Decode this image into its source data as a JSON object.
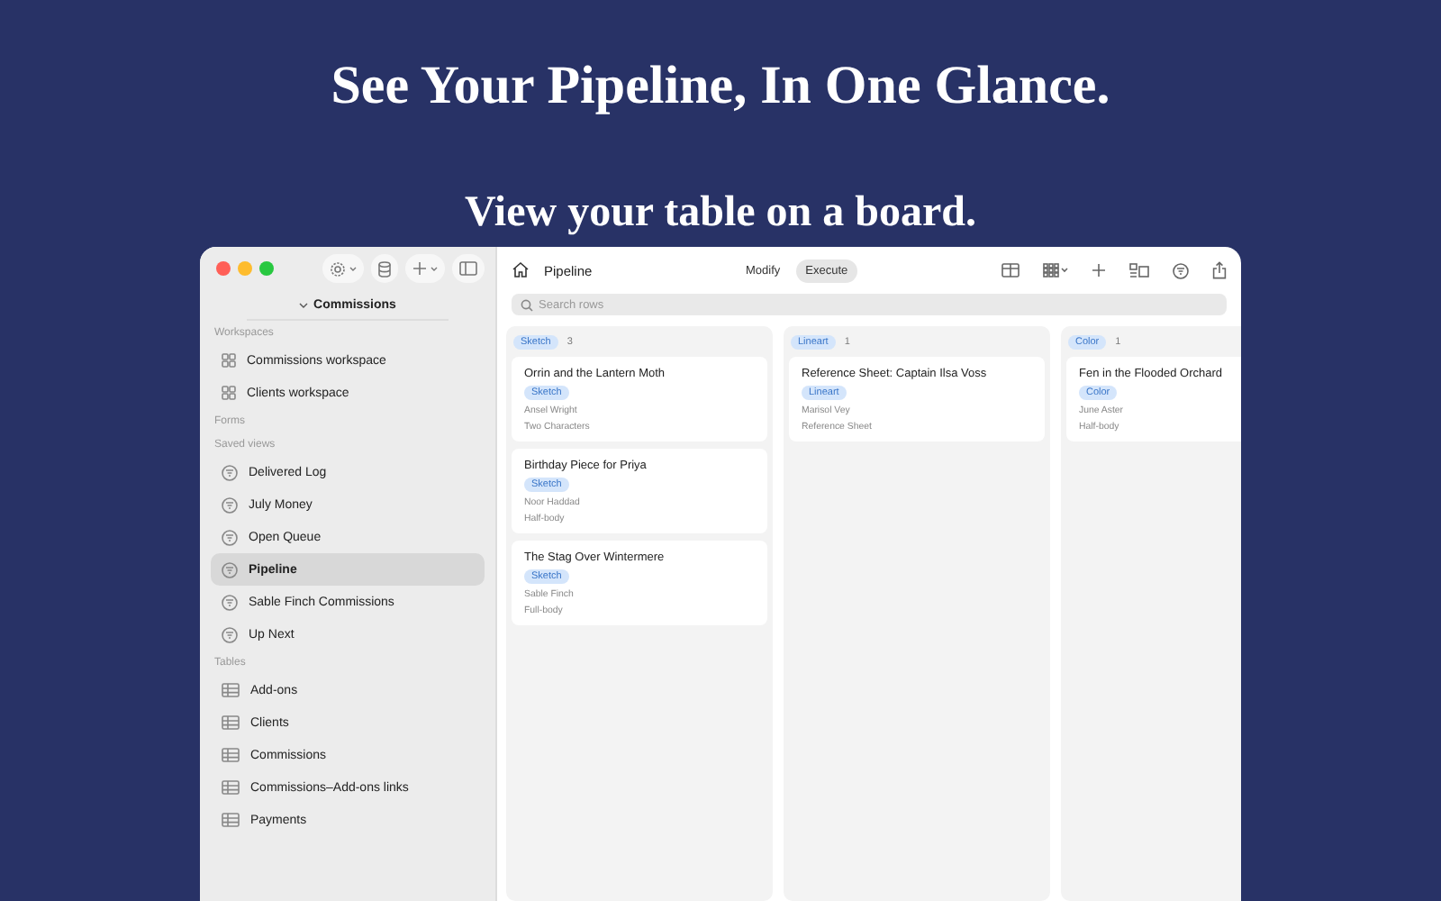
{
  "hero": {
    "title": "See Your Pipeline, In One Glance.",
    "subtitle": "View your table on a board."
  },
  "sidebar": {
    "header": "Commissions",
    "sections": [
      {
        "label": "Workspaces",
        "items": [
          {
            "label": "Commissions workspace",
            "kind": "workspace",
            "selected": false
          },
          {
            "label": "Clients workspace",
            "kind": "workspace",
            "selected": false
          }
        ]
      },
      {
        "label": "Forms"
      },
      {
        "label": "Saved views",
        "items": [
          {
            "label": "Delivered Log",
            "kind": "view",
            "selected": false
          },
          {
            "label": "July Money",
            "kind": "view",
            "selected": false
          },
          {
            "label": "Open Queue",
            "kind": "view",
            "selected": false
          },
          {
            "label": "Pipeline",
            "kind": "view",
            "selected": true
          },
          {
            "label": "Sable Finch Commissions",
            "kind": "view",
            "selected": false
          },
          {
            "label": "Up Next",
            "kind": "view",
            "selected": false
          }
        ]
      },
      {
        "label": "Tables",
        "items": [
          {
            "label": "Add-ons",
            "kind": "table",
            "selected": false
          },
          {
            "label": "Clients",
            "kind": "table",
            "selected": false
          },
          {
            "label": "Commissions",
            "kind": "table",
            "selected": false
          },
          {
            "label": "Commissions–Add-ons links",
            "kind": "table",
            "selected": false
          },
          {
            "label": "Payments",
            "kind": "table",
            "selected": false
          }
        ]
      }
    ]
  },
  "toolbar": {
    "title": "Pipeline",
    "modes": [
      {
        "label": "Modify",
        "selected": false
      },
      {
        "label": "Execute",
        "selected": true
      }
    ]
  },
  "search": {
    "placeholder": "Search rows"
  },
  "board": {
    "columns": [
      {
        "tag": "Sketch",
        "count": "3",
        "cards": [
          {
            "title": "Orrin and the Lantern Moth",
            "tag": "Sketch",
            "client": "Ansel Wright",
            "type": "Two Characters"
          },
          {
            "title": "Birthday Piece for Priya",
            "tag": "Sketch",
            "client": "Noor Haddad",
            "type": "Half-body"
          },
          {
            "title": "The Stag Over Wintermere",
            "tag": "Sketch",
            "client": "Sable Finch",
            "type": "Full-body"
          }
        ]
      },
      {
        "tag": "Lineart",
        "count": "1",
        "cards": [
          {
            "title": "Reference Sheet: Captain Ilsa Voss",
            "tag": "Lineart",
            "client": "Marisol Vey",
            "type": "Reference Sheet"
          }
        ]
      },
      {
        "tag": "Color",
        "count": "1",
        "cards": [
          {
            "title": "Fen in the Flooded Orchard",
            "tag": "Color",
            "client": "June Aster",
            "type": "Half-body"
          }
        ]
      }
    ]
  }
}
